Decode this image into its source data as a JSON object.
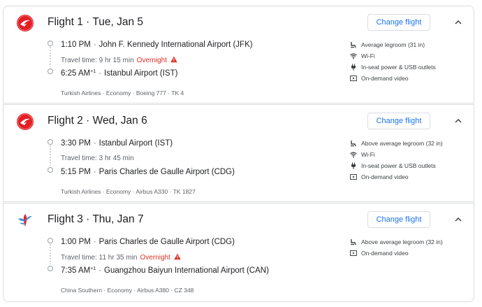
{
  "flights": [
    {
      "title": "Flight 1 · Tue, Jan 5",
      "airline_logo": "turkish-airlines-logo",
      "change_label": "Change flight",
      "departure": {
        "time": "1:10 PM",
        "airport": "John F. Kennedy International Airport (JFK)"
      },
      "travel_time": "Travel time: 9 hr 15 min",
      "overnight": "Overnight",
      "arrival": {
        "time": "6:25 AM",
        "day_offset": "+1",
        "airport": "Istanbul Airport (IST)"
      },
      "details": "Turkish Airlines · Economy · Boeing 777 · TK 4",
      "amenities": [
        {
          "icon": "legroom-icon",
          "label": "Average legroom (31 in)"
        },
        {
          "icon": "wifi-icon",
          "label": "Wi-Fi"
        },
        {
          "icon": "power-plug-icon",
          "label": "In-seat power & USB outlets"
        },
        {
          "icon": "video-icon",
          "label": "On-demand video"
        }
      ]
    },
    {
      "title": "Flight 2 · Wed, Jan 6",
      "airline_logo": "turkish-airlines-logo",
      "change_label": "Change flight",
      "departure": {
        "time": "3:30 PM",
        "airport": "Istanbul Airport (IST)"
      },
      "travel_time": "Travel time: 3 hr 45 min",
      "overnight": "",
      "arrival": {
        "time": "5:15 PM",
        "day_offset": "",
        "airport": "Paris Charles de Gaulle Airport (CDG)"
      },
      "details": "Turkish Airlines · Economy · Airbus A330 · TK 1827",
      "amenities": [
        {
          "icon": "legroom-icon",
          "label": "Above average legroom (32 in)"
        },
        {
          "icon": "wifi-icon",
          "label": "Wi-Fi"
        },
        {
          "icon": "power-plug-icon",
          "label": "In-seat power & USB outlets"
        },
        {
          "icon": "video-icon",
          "label": "On-demand video"
        }
      ]
    },
    {
      "title": "Flight 3 · Thu, Jan 7",
      "airline_logo": "china-southern-logo",
      "change_label": "Change flight",
      "departure": {
        "time": "1:00 PM",
        "airport": "Paris Charles de Gaulle Airport (CDG)"
      },
      "travel_time": "Travel time: 11 hr 35 min",
      "overnight": "Overnight",
      "arrival": {
        "time": "7:35 AM",
        "day_offset": "+1",
        "airport": "Guangzhou Baiyun International Airport (CAN)"
      },
      "details": "China Southern · Economy · Airbus A380 · CZ 348",
      "amenities": [
        {
          "icon": "legroom-icon",
          "label": "Above average legroom (32 in)"
        },
        {
          "icon": "video-icon",
          "label": "On-demand video"
        }
      ]
    }
  ],
  "colors": {
    "accent": "#1a73e8",
    "warning": "#d93025",
    "turkish_red": "#e31e24",
    "china_southern_blue": "#3a8fd9",
    "china_southern_red": "#e0262d"
  }
}
